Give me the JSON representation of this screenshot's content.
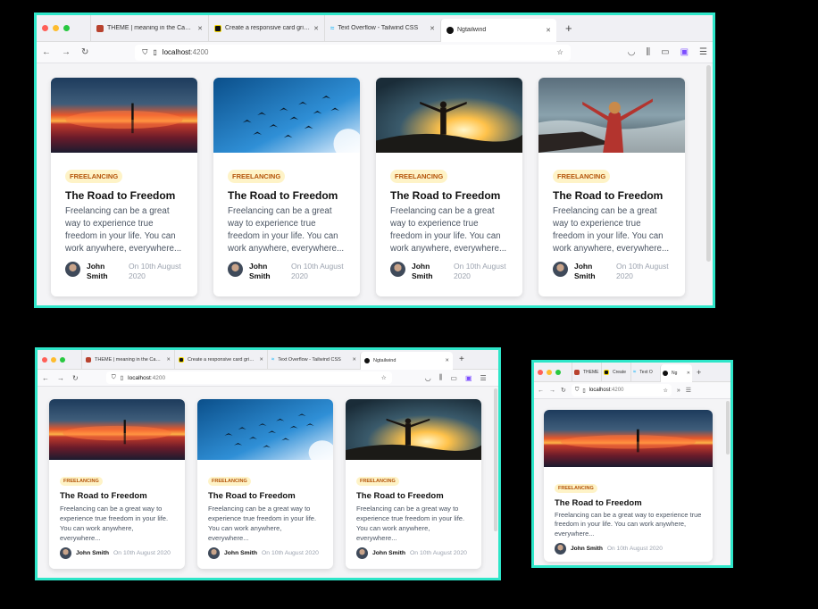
{
  "tabs": [
    {
      "title": "THEME | meaning in the Cambridge English Dictionary",
      "favicon": "cambridge-icon"
    },
    {
      "title": "Create a responsive card grid with Tailwind",
      "favicon": "codepen-icon"
    },
    {
      "title": "Text Overflow - Tailwind CSS",
      "favicon": "tailwind-icon"
    },
    {
      "title": "Ngtailwind",
      "favicon": "angular-icon"
    }
  ],
  "new_tab": "+",
  "url": {
    "host": "localhost",
    "port": ":4200"
  },
  "card": {
    "badge": "Freelancing",
    "title": "The Road to Freedom",
    "desc_wide": "Freelancing can be a great way to experience true freedom in your life. You can work anywhere, everywhere...",
    "author": "John Smith",
    "author_first": "John",
    "author_last": "Smith",
    "date": "On 10th August 2020",
    "date_line1": "On 10th August",
    "date_line2": "2020"
  },
  "narrow_tabs": [
    "THEME",
    "Create",
    "Text O",
    "Ng"
  ],
  "medium_tabs": [
    "THEME | meaning in the Cambri",
    "Create a responsive card grid w",
    "Text Overflow - Tailwind CSS",
    "Ngtailwind"
  ],
  "colors": {
    "frame": "#2ee6c9",
    "badge_bg": "#fef3c7",
    "badge_text": "#b45309"
  }
}
